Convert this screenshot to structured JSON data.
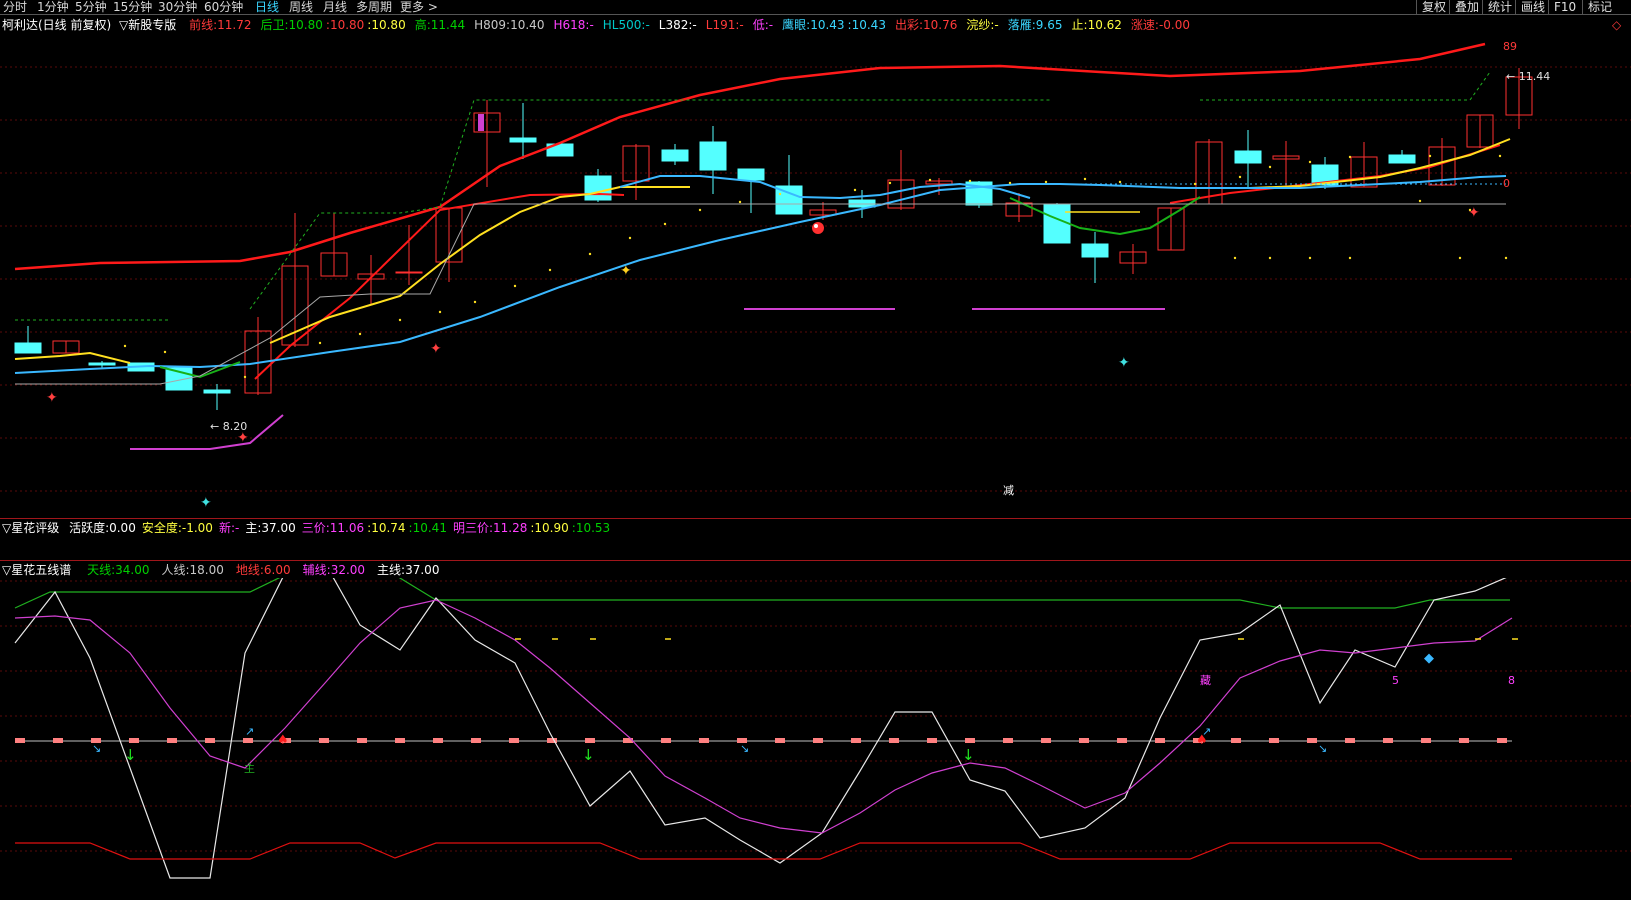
{
  "topbar": {
    "periods": [
      "分时",
      "1分钟",
      "5分钟",
      "15分钟",
      "30分钟",
      "60分钟",
      "日线",
      "周线",
      "月线",
      "多周期",
      "更多 >"
    ],
    "active_period": "日线",
    "right_buttons": [
      "复权",
      "叠加",
      "统计",
      "画线",
      "F10",
      "标记"
    ]
  },
  "main": {
    "title": "柯利达(日线 前复权)",
    "indicator": "▽新股专版",
    "fields": [
      {
        "label": "前线:",
        "value": "11.72",
        "color": "#ff3a3a"
      },
      {
        "label": "后卫:",
        "value": "10.80",
        "color": "#00d000"
      },
      {
        "label": ":",
        "value": "10.80",
        "color": "#ff3a3a"
      },
      {
        "label": ":",
        "value": "10.80",
        "color": "#ffff40"
      },
      {
        "label": "高:",
        "value": "11.44",
        "color": "#00d000"
      },
      {
        "label": "H809:",
        "value": "10.40",
        "color": "#c8c8c8"
      },
      {
        "label": "H618:",
        "value": "-",
        "color": "#ff40ff"
      },
      {
        "label": "HL500:",
        "value": "-",
        "color": "#00c8c8"
      },
      {
        "label": "L382:",
        "value": "-",
        "color": "#ffffff"
      },
      {
        "label": "L191:",
        "value": "-",
        "color": "#ff3a3a"
      },
      {
        "label": "低:",
        "value": "-",
        "color": "#ff40ff"
      },
      {
        "label": "鹰眼:",
        "value": "10.43",
        "color": "#3ad6ff"
      },
      {
        "label": ":",
        "value": "10.43",
        "color": "#3ad6ff"
      },
      {
        "label": "出彩:",
        "value": "10.76",
        "color": "#ff3a3a"
      },
      {
        "label": "浣纱:",
        "value": "-",
        "color": "#ffff40"
      },
      {
        "label": "落雁:",
        "value": "9.65",
        "color": "#3ad6ff"
      },
      {
        "label": "止:",
        "value": "10.62",
        "color": "#ffff40"
      },
      {
        "label": "涨速:",
        "value": "-0.00",
        "color": "#ff3a3a"
      }
    ],
    "labels": {
      "high": "11.44",
      "low": "8.20",
      "right_top": "89",
      "right_mid": "0",
      "jian": "减"
    }
  },
  "panel2": {
    "title": "▽星花评级",
    "fields": [
      {
        "label": "活跃度:",
        "value": "0.00",
        "color": "#ffffff"
      },
      {
        "label": "安全度:",
        "value": "-1.00",
        "color": "#ffff40"
      },
      {
        "label": "新:",
        "value": "-",
        "color": "#ff40ff"
      },
      {
        "label": "主:",
        "value": "37.00",
        "color": "#ffffff"
      },
      {
        "label": "三价:",
        "value": "11.06",
        "color": "#ff40ff"
      },
      {
        "label": ":",
        "value": "10.74",
        "color": "#ffff40"
      },
      {
        "label": ":",
        "value": "10.41",
        "color": "#00d000"
      },
      {
        "label": "明三价:",
        "value": "11.28",
        "color": "#ff40ff"
      },
      {
        "label": ":",
        "value": "10.90",
        "color": "#ffff40"
      },
      {
        "label": ":",
        "value": "10.53",
        "color": "#00d000"
      }
    ]
  },
  "panel3": {
    "title": "▽星花五线谱",
    "fields": [
      {
        "label": "天线:",
        "value": "34.00",
        "color": "#00d000"
      },
      {
        "label": "人线:",
        "value": "18.00",
        "color": "#c8c8c8"
      },
      {
        "label": "地线:",
        "value": "6.00",
        "color": "#ff3a3a"
      },
      {
        "label": "辅线:",
        "value": "32.00",
        "color": "#ff40ff"
      },
      {
        "label": "主线:",
        "value": "37.00",
        "color": "#ffffff"
      }
    ],
    "labels": {
      "zhu": "主",
      "cang": "藏",
      "five": "5",
      "eight": "8"
    }
  }
}
